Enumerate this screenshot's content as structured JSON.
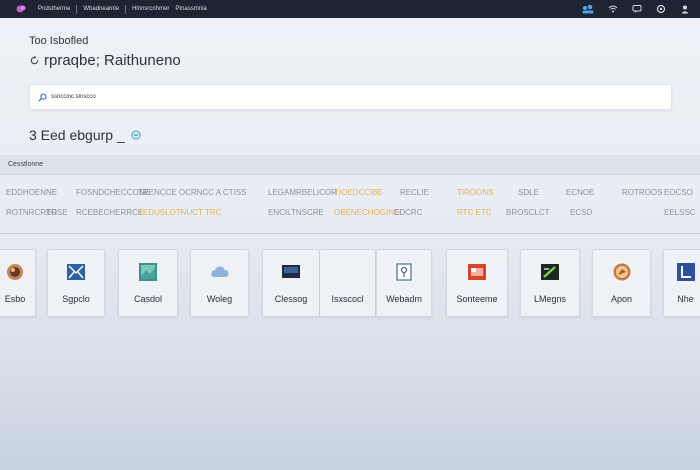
{
  "topbar": {
    "nav": [
      "Pndstherme",
      "Wbadnearnle",
      "Hlnnsrcnhmer",
      "Ptnassmnia"
    ],
    "icons": [
      "people-icon",
      "wifi-icon",
      "chat-icon",
      "settings-icon",
      "user-icon"
    ]
  },
  "header": {
    "subtitle": "Too Isbofled",
    "title": "rpraqbe; Raithuneno"
  },
  "search": {
    "value": "ssnccinc slnscco"
  },
  "count_line": "3 Eed ebgurp _",
  "section": {
    "title": "Cesstlonne"
  },
  "table": {
    "rows": [
      [
        "EDDHOENNE",
        "FOSNDCHECCOSE",
        "TRENCCE OCRNCC A CTISS",
        "LEGAMRBELICOR",
        "TIOEDCCIBE",
        "RECLIE",
        "TIROONS",
        "SDLE",
        "ECNOE",
        "ROTROOS",
        "EOCSO"
      ],
      [
        "ROTNRCRER",
        "TOSE",
        "RCEBECHERRCE",
        "TEDUSLOTNUCT TRC",
        "ENCILTNSCRE",
        "OBENECHOGING",
        "EDCRC",
        "RTC ETC",
        "BROSCLCT",
        "ECSD",
        "EELSSC"
      ]
    ]
  },
  "tiles": [
    {
      "label": "Esbo",
      "icon": "globe-icon"
    },
    {
      "label": "Sgpclo",
      "icon": "mail-icon"
    },
    {
      "label": "Casdol",
      "icon": "image-icon"
    },
    {
      "label": "Woleg",
      "icon": "cloud-icon"
    },
    {
      "label": "Clessog",
      "icon": "monitor-icon"
    },
    {
      "label": "Isxscocl",
      "icon": "blank-icon"
    },
    {
      "label": "Webadm",
      "icon": "document-icon"
    },
    {
      "label": "Sonteeme",
      "icon": "calendar-icon"
    },
    {
      "label": "LMegns",
      "icon": "terminal-icon"
    },
    {
      "label": "Apon",
      "icon": "compass-icon"
    },
    {
      "label": "Nhe",
      "icon": "chart-icon"
    }
  ],
  "colors": {
    "topbar": "#1d2533",
    "accent": "#2a7fd4",
    "highlight": "#e1a93a"
  }
}
